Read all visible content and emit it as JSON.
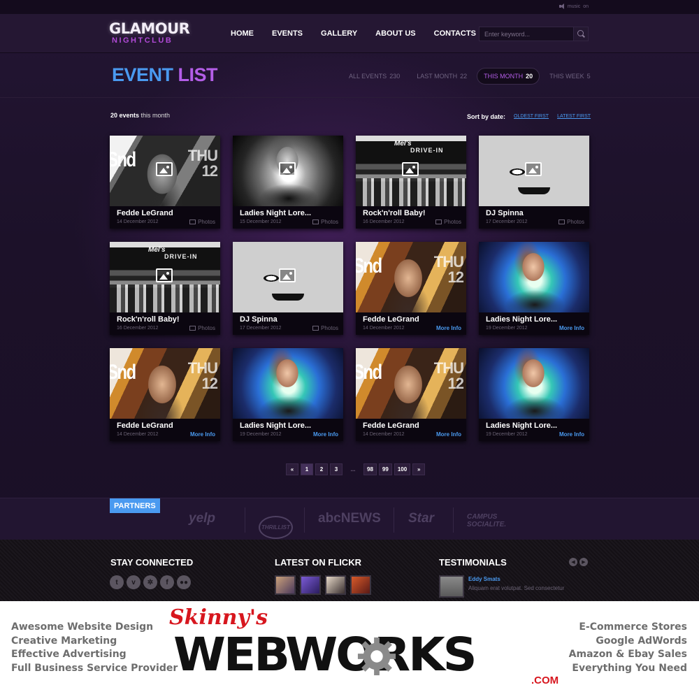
{
  "topbar": {
    "music_label": "music",
    "music_state": "on"
  },
  "header": {
    "logo_main": "GLAMOUR",
    "logo_sub": "NIGHTCLUB",
    "nav": [
      "HOME",
      "EVENTS",
      "GALLERY",
      "ABOUT US",
      "CONTACTS"
    ],
    "search_placeholder": "Enter keyword..."
  },
  "title": {
    "part1": "EVENT",
    "part2": "LIST"
  },
  "filters": [
    {
      "label": "ALL EVENTS",
      "count": "230",
      "active": false
    },
    {
      "label": "LAST MONTH",
      "count": "22",
      "active": false
    },
    {
      "label": "THIS MONTH",
      "count": "20",
      "active": true
    },
    {
      "label": "THIS WEEK",
      "count": "5",
      "active": false
    }
  ],
  "count_line": {
    "number": "20 events",
    "suffix": " this month"
  },
  "sort": {
    "label": "Sort by date:",
    "oldest": "OLDEST FIRST",
    "latest": "LATEST FIRST"
  },
  "events": [
    {
      "title": "Fedde LeGrand",
      "date": "14 December 2012",
      "link": "Photos",
      "art": "fedde-bw"
    },
    {
      "title": "Ladies Night Lore...",
      "date": "15 December 2012",
      "link": "Photos",
      "art": "ladies-bw"
    },
    {
      "title": "Rock'n'roll Baby!",
      "date": "16 December 2012",
      "link": "Photos",
      "art": "drive"
    },
    {
      "title": "DJ Spinna",
      "date": "17 December 2012",
      "link": "Photos",
      "art": "spinna"
    },
    {
      "title": "Rock'n'roll Baby!",
      "date": "16 December 2012",
      "link": "Photos",
      "art": "drive"
    },
    {
      "title": "DJ Spinna",
      "date": "17 December 2012",
      "link": "Photos",
      "art": "spinna"
    },
    {
      "title": "Fedde LeGrand",
      "date": "14 December 2012",
      "link": "More Info",
      "art": "fedde-color"
    },
    {
      "title": "Ladies Night Lore...",
      "date": "19 December 2012",
      "link": "More Info",
      "art": "ladies-color"
    },
    {
      "title": "Fedde LeGrand",
      "date": "14 December 2012",
      "link": "More Info",
      "art": "fedde-color"
    },
    {
      "title": "Ladies Night Lore...",
      "date": "19 December 2012",
      "link": "More Info",
      "art": "ladies-color"
    },
    {
      "title": "Fedde LeGrand",
      "date": "14 December 2012",
      "link": "More Info",
      "art": "fedde-color"
    },
    {
      "title": "Ladies Night Lore...",
      "date": "19 December 2012",
      "link": "More Info",
      "art": "ladies-color"
    }
  ],
  "thumb_text": {
    "drive_sign": "Mel's",
    "drive_sign2": "DRIVE-IN",
    "fedde_big": "Snd",
    "fedde_day": "THU",
    "fedde_num": "12"
  },
  "pagination": [
    "«",
    "1",
    "2",
    "3",
    "...",
    "98",
    "99",
    "100",
    "»"
  ],
  "pagination_active": "1",
  "partners": {
    "label": "PARTNERS",
    "logos": [
      "yelp",
      "THRILLIST",
      "abcNEWS",
      "Star",
      "CAMPUS SOCIALITE."
    ]
  },
  "footer": {
    "stay_connected": "STAY CONNECTED",
    "flickr": "LATEST ON FLICKR",
    "testimonials": "TESTIMONIALS",
    "social": [
      "t",
      "v",
      "s",
      "f",
      "fl"
    ],
    "testimonial_name": "Eddy Smats",
    "testimonial_text": "Aliquam erat volutpat. Sed consectetur"
  },
  "banner": {
    "left": [
      "Awesome Website Design",
      "Creative Marketing",
      "Effective Advertising",
      "Full Business Service Provider"
    ],
    "right": [
      "E-Commerce Stores",
      "Google AdWords",
      "Amazon & Ebay Sales",
      "Everything You Need"
    ],
    "skinny": "Skinny's",
    "webworks": "WEBWORKS",
    "com": ".COM"
  },
  "colors": {
    "accent_blue": "#4a9af0",
    "accent_purple": "#b45ee8",
    "brand_red": "#d7161e"
  }
}
